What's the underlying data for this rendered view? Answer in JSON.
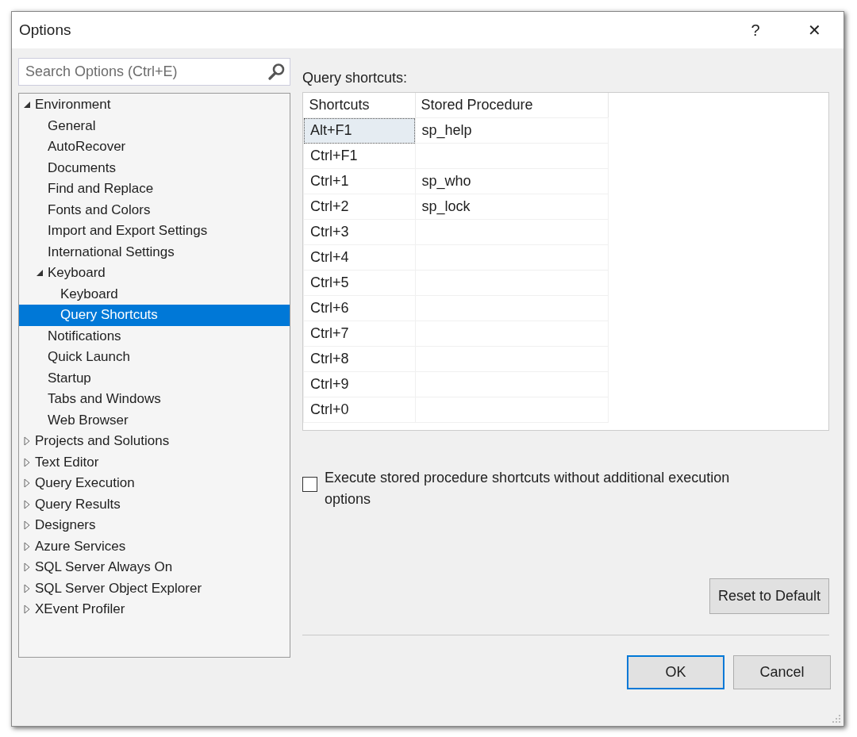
{
  "window": {
    "title": "Options",
    "help": "?",
    "close": "✕"
  },
  "search": {
    "placeholder": "Search Options (Ctrl+E)"
  },
  "tree": [
    {
      "label": "Environment",
      "expanded": true,
      "selected": false,
      "children": [
        {
          "label": "General",
          "selected": false
        },
        {
          "label": "AutoRecover",
          "selected": false
        },
        {
          "label": "Documents",
          "selected": false
        },
        {
          "label": "Find and Replace",
          "selected": false
        },
        {
          "label": "Fonts and Colors",
          "selected": false
        },
        {
          "label": "Import and Export Settings",
          "selected": false
        },
        {
          "label": "International Settings",
          "selected": false
        },
        {
          "label": "Keyboard",
          "expanded": true,
          "selected": false,
          "children": [
            {
              "label": "Keyboard",
              "selected": false
            },
            {
              "label": "Query Shortcuts",
              "selected": true
            }
          ]
        },
        {
          "label": "Notifications",
          "selected": false
        },
        {
          "label": "Quick Launch",
          "selected": false
        },
        {
          "label": "Startup",
          "selected": false
        },
        {
          "label": "Tabs and Windows",
          "selected": false
        },
        {
          "label": "Web Browser",
          "selected": false
        }
      ]
    },
    {
      "label": "Projects and Solutions",
      "expanded": false,
      "selected": false
    },
    {
      "label": "Text Editor",
      "expanded": false,
      "selected": false
    },
    {
      "label": "Query Execution",
      "expanded": false,
      "selected": false
    },
    {
      "label": "Query Results",
      "expanded": false,
      "selected": false
    },
    {
      "label": "Designers",
      "expanded": false,
      "selected": false
    },
    {
      "label": "Azure Services",
      "expanded": false,
      "selected": false
    },
    {
      "label": "SQL Server Always On",
      "expanded": false,
      "selected": false
    },
    {
      "label": "SQL Server Object Explorer",
      "expanded": false,
      "selected": false
    },
    {
      "label": "XEvent Profiler",
      "expanded": false,
      "selected": false
    }
  ],
  "shortcuts_label": "Query shortcuts:",
  "table": {
    "columns": [
      "Shortcuts",
      "Stored Procedure"
    ],
    "rows": [
      {
        "shortcut": "Alt+F1",
        "procedure": "sp_help",
        "selected": true
      },
      {
        "shortcut": "Ctrl+F1",
        "procedure": "",
        "selected": false
      },
      {
        "shortcut": "Ctrl+1",
        "procedure": "sp_who",
        "selected": false
      },
      {
        "shortcut": "Ctrl+2",
        "procedure": "sp_lock",
        "selected": false
      },
      {
        "shortcut": "Ctrl+3",
        "procedure": "",
        "selected": false
      },
      {
        "shortcut": "Ctrl+4",
        "procedure": "",
        "selected": false
      },
      {
        "shortcut": "Ctrl+5",
        "procedure": "",
        "selected": false
      },
      {
        "shortcut": "Ctrl+6",
        "procedure": "",
        "selected": false
      },
      {
        "shortcut": "Ctrl+7",
        "procedure": "",
        "selected": false
      },
      {
        "shortcut": "Ctrl+8",
        "procedure": "",
        "selected": false
      },
      {
        "shortcut": "Ctrl+9",
        "procedure": "",
        "selected": false
      },
      {
        "shortcut": "Ctrl+0",
        "procedure": "",
        "selected": false
      }
    ]
  },
  "checkbox": {
    "label": "Execute stored procedure shortcuts without additional execution options",
    "checked": false
  },
  "reset_button": "Reset to Default",
  "buttons": [
    {
      "label": "OK",
      "default": true
    },
    {
      "label": "Cancel",
      "default": false
    }
  ]
}
